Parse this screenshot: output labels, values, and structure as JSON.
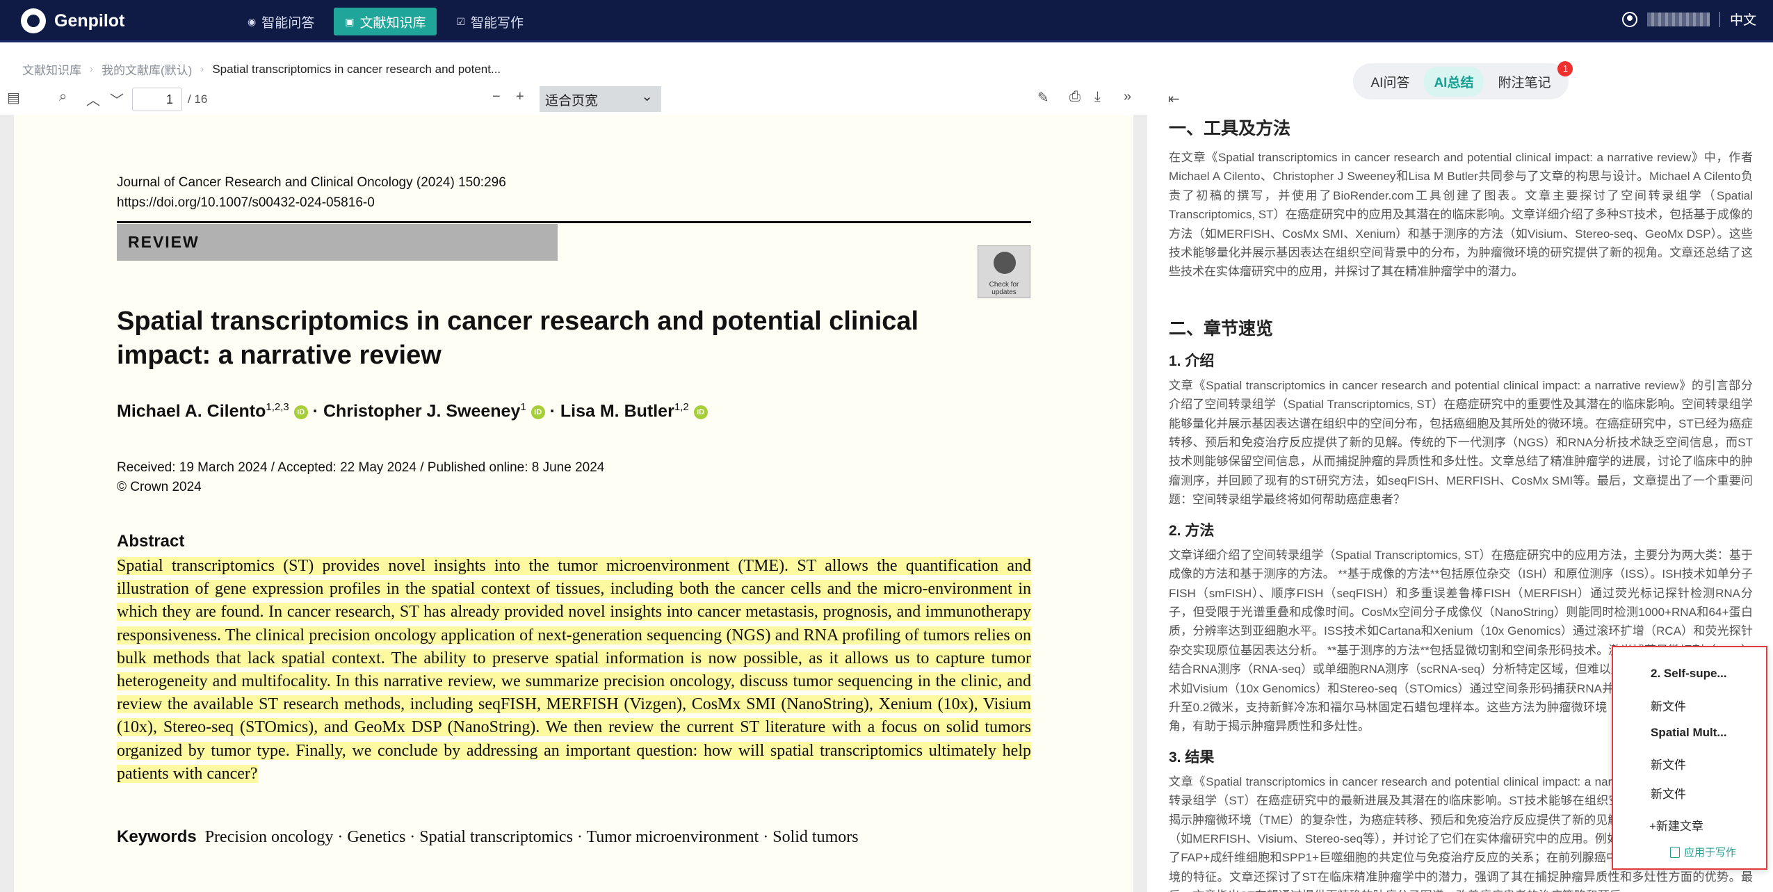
{
  "topbar": {
    "brand": "Genpilot",
    "nav": [
      {
        "icon": "chat-icon",
        "label": "智能问答"
      },
      {
        "icon": "library-icon",
        "label": "文献知识库"
      },
      {
        "icon": "edit-icon",
        "label": "智能写作"
      }
    ],
    "language": "中文"
  },
  "breadcrumb": [
    "文献知识库",
    "我的文献库(默认)",
    "Spatial transcriptomics in cancer research and potent..."
  ],
  "pdf_toolbar": {
    "page_current": "1",
    "page_total": "/ 16",
    "zoom": "适合页宽"
  },
  "paper": {
    "journal_line": "Journal of Cancer Research and Clinical Oncology (2024) 150:296",
    "doi": "https://doi.org/10.1007/s00432-024-05816-0",
    "section_label": "REVIEW",
    "badge_text": "Check for updates",
    "title": "Spatial transcriptomics in cancer research and potential clinical impact: a narrative review",
    "author1": "Michael A. Cilento",
    "author1_sup": "1,2,3",
    "author2": "Christopher J. Sweeney",
    "author2_sup": "1",
    "author3": "Lisa M. Butler",
    "author3_sup": "1,2",
    "dates": "Received: 19 March 2024 / Accepted: 22 May 2024 / Published online: 8 June 2024",
    "copyright": "© Crown 2024",
    "abstract_heading": "Abstract",
    "abstract": "Spatial transcriptomics (ST) provides novel insights into the tumor microenvironment (TME). ST allows the quantification and illustration of gene expression profiles in the spatial context of tissues, including both the cancer cells and the micro-environment in which they are found. In cancer research, ST has already provided novel insights into cancer metastasis, prognosis, and immunotherapy responsiveness. The clinical precision oncology application of next-generation sequencing (NGS) and RNA profiling of tumors relies on bulk methods that lack spatial context. The ability to preserve spatial information is now possible, as it allows us to capture tumor heterogeneity and multifocality. In this narrative review, we summarize precision oncology, discuss tumor sequencing in the clinic, and review the available ST research methods, including seqFISH, MERFISH (Vizgen), CosMx SMI (NanoString), Xenium (10x), Visium (10x), Stereo-seq (STOmics), and GeoMx DSP (NanoString). We then review the current ST literature with a focus on solid tumors organized by tumor type. Finally, we conclude by addressing an important question: how will spatial transcriptomics ultimately help patients with cancer?",
    "keywords_label": "Keywords",
    "keywords": "Precision oncology · Genetics · Spatial transcriptomics · Tumor microenvironment · Solid tumors"
  },
  "right_panel": {
    "tabs": [
      "AI问答",
      "AI总结",
      "附注笔记"
    ],
    "active_tab": "AI总结",
    "notes_badge": "1",
    "sections": {
      "h1a": "一、工具及方法",
      "p1": "在文章《Spatial transcriptomics in cancer research and potential clinical impact: a narrative review》中，作者Michael A Cilento、Christopher J Sweeney和Lisa M Butler共同参与了文章的构思与设计。Michael A Cilento负责了初稿的撰写，并使用了BioRender.com工具创建了图表。文章主要探讨了空间转录组学（Spatial Transcriptomics, ST）在癌症研究中的应用及其潜在的临床影响。文章详细介绍了多种ST技术，包括基于成像的方法（如MERFISH、CosMx SMI、Xenium）和基于测序的方法（如Visium、Stereo-seq、GeoMx DSP）。这些技术能够量化并展示基因表达在组织空间背景中的分布，为肿瘤微环境的研究提供了新的视角。文章还总结了这些技术在实体瘤研究中的应用，并探讨了其在精准肿瘤学中的潜力。",
      "h1b": "二、章节速览",
      "h2a": "1. 介绍",
      "p2": "文章《Spatial transcriptomics in cancer research and potential clinical impact: a narrative review》的引言部分介绍了空间转录组学（Spatial Transcriptomics, ST）在癌症研究中的重要性及其潜在的临床影响。空间转录组学能够量化并展示基因表达谱在组织中的空间分布，包括癌细胞及其所处的微环境。在癌症研究中，ST已经为癌症转移、预后和免疫治疗反应提供了新的见解。传统的下一代测序（NGS）和RNA分析技术缺乏空间信息，而ST技术则能够保留空间信息，从而捕捉肿瘤的异质性和多灶性。文章总结了精准肿瘤学的进展，讨论了临床中的肿瘤测序，并回顾了现有的ST研究方法，如seqFISH、MERFISH、CosMx SMI等。最后，文章提出了一个重要问题：空间转录组学最终将如何帮助癌症患者？",
      "h2b": "2. 方法",
      "p3": "文章详细介绍了空间转录组学（Spatial Transcriptomics, ST）在癌症研究中的应用方法，主要分为两大类：基于成像的方法和基于测序的方法。 **基于成像的方法**包括原位杂交（ISH）和原位测序（ISS）。ISH技术如单分子FISH（smFISH）、顺序FISH（seqFISH）和多重误差鲁棒FISH（MERFISH）通过荧光标记探针检测RNA分子，但受限于光谱重叠和成像时间。CosMx空间分子成像仪（NanoString）则能同时检测1000+RNA和64+蛋白质，分辨率达到亚细胞水平。ISS技术如Cartana和Xenium（10x Genomics）通过滚环扩增（RCA）和荧光探针杂交实现原位基因表达分析。 **基于测序的方法**包括显微切割和空间条形码技术。激光捕获显微切割（LCM）结合RNA测序（RNA-seq）或单细胞RNA测序（scRNA-seq）分析特定区域，但难以处理大样本。空间条形码技术如Visium（10x Genomics）和Stereo-seq（STOmics）通过空间条形码捕获RNA并测序，分辨率从100微米提升至0.2微米，支持新鲜冷冻和福尔马林固定石蜡包埋样本。这些方法为肿瘤微环境（TME）研究提供了新的视角，有助于揭示肿瘤异质性和多灶性。",
      "h2c": "3. 结果",
      "p4": "文章《Spatial transcriptomics in cancer research and potential clinical impact: a narrative review》介绍了空间转录组学（ST）在癌症研究中的最新进展及其潜在的临床影响。ST技术能够在组织空间背景下量化基因表达，揭示肿瘤微环境（TME）的复杂性，为癌症转移、预后和免疫治疗反应提供了新的见解。文章总结了多种ST技术（如MERFISH、Visium、Stereo-seq等），并讨论了它们在实体瘤研究中的应用。例如，在结直肠癌中，ST揭示了FAP+成纤维细胞和SPP1+巨噬细胞的共定位与免疫治疗反应的关系；在前列腺癌中，ST揭示了免疫抑制微环境的特征。文章还探讨了ST在临床精准肿瘤学中的潜力，强调了其在捕捉肿瘤异质性和多灶性方面的优势。最后，文章指出ST有望通过提供更精确的肿瘤分子图谱，改善癌症患者的治疗策略和预后。"
    }
  },
  "popup": {
    "items": [
      "2. Self-supe...",
      "新文件",
      "Spatial Mult...",
      "新文件",
      "新文件"
    ],
    "new_article": "+新建文章",
    "apply": "应用于写作"
  },
  "colors": {
    "topbar_bg": "#0f1b44",
    "accent_teal": "#1fa59a",
    "highlight_yellow": "#fdf9a1",
    "popup_border": "#e23a3a",
    "badge_red": "#f0302e"
  }
}
